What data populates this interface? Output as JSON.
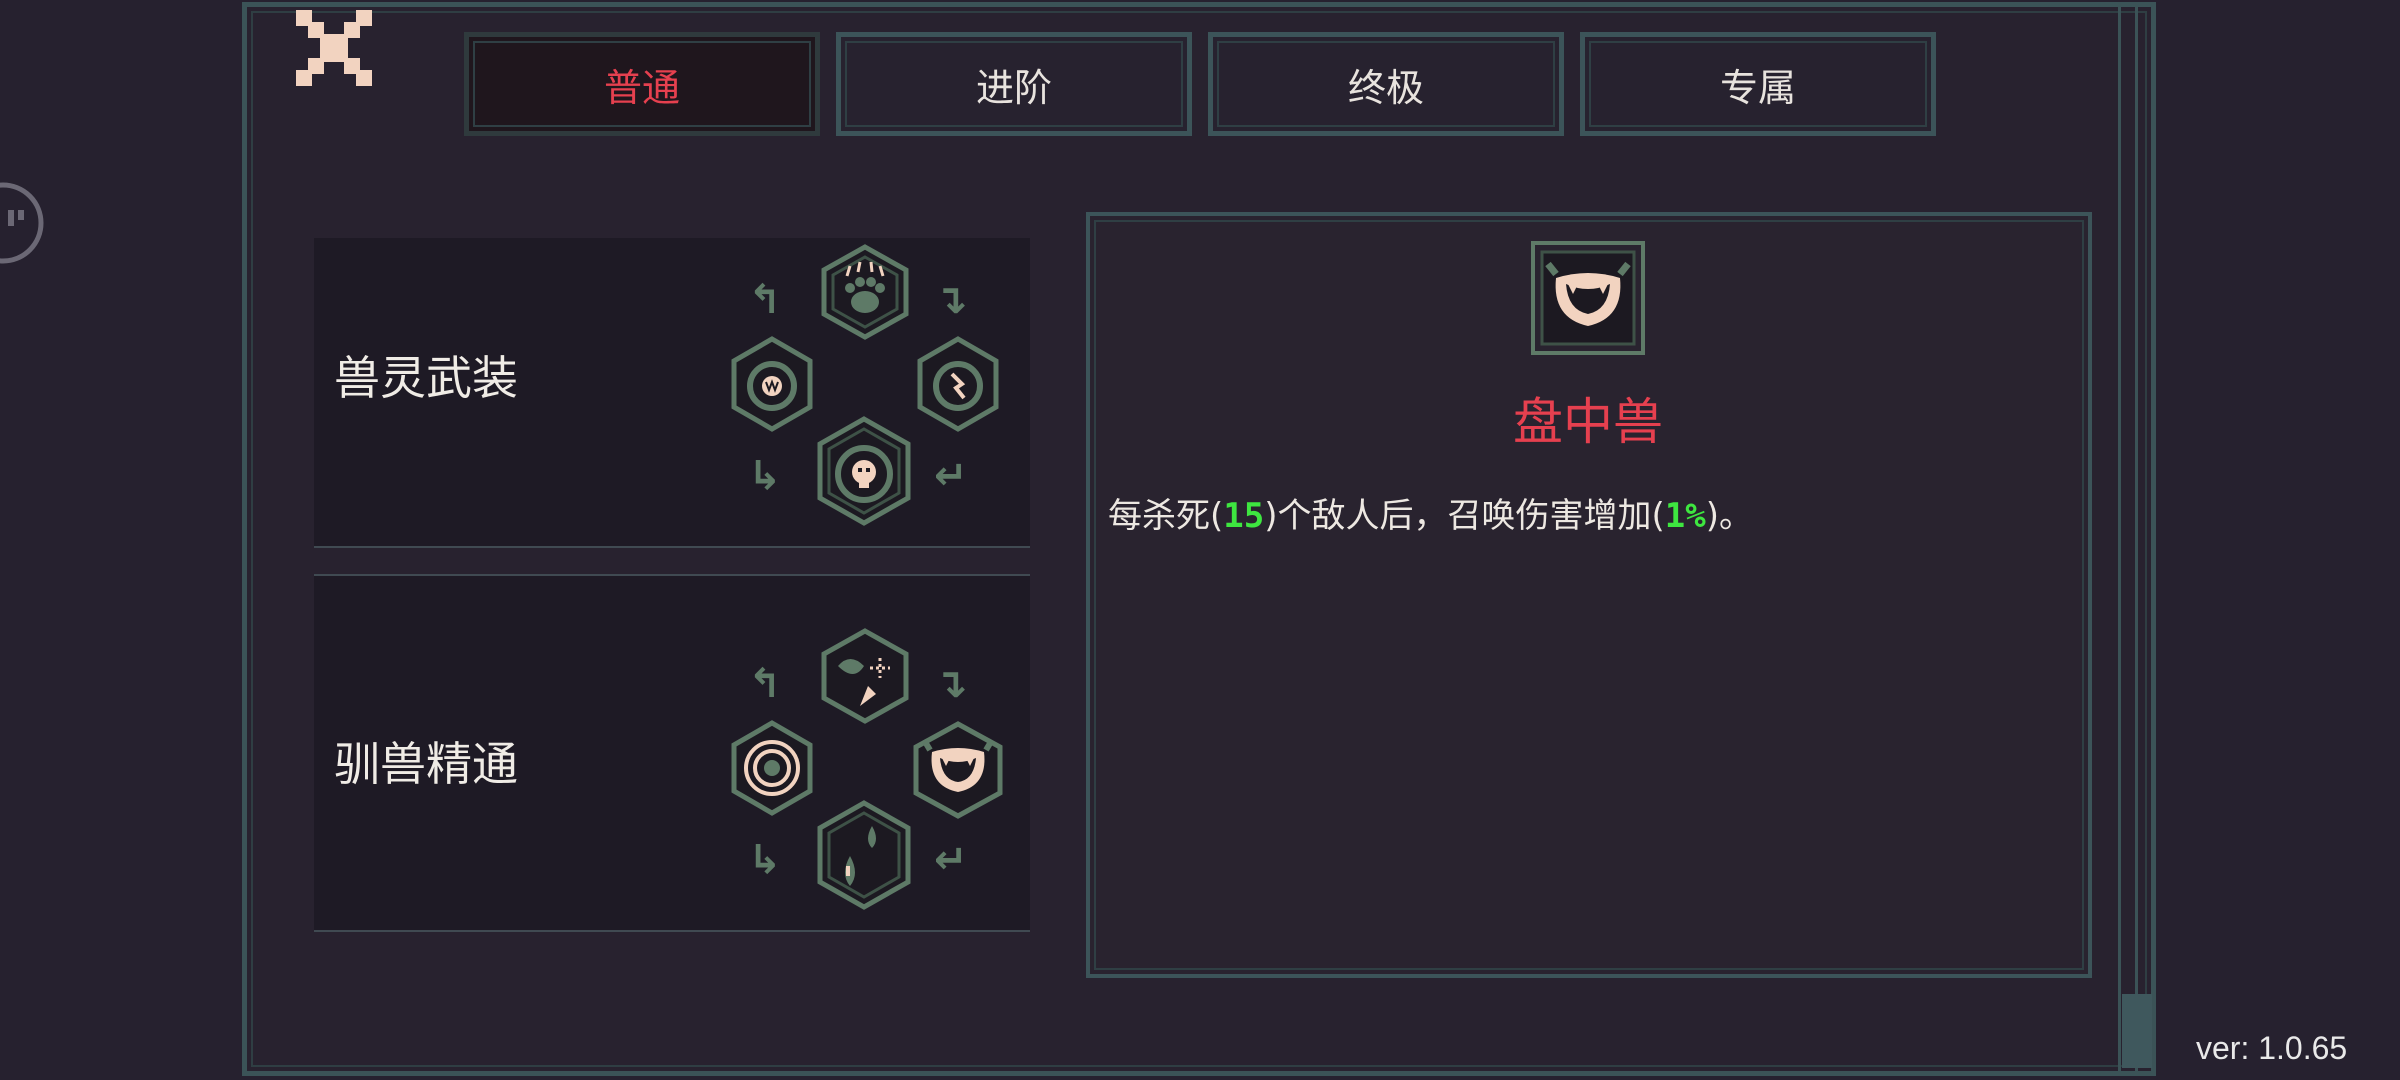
{
  "tabs": [
    {
      "label": "普通",
      "active": true
    },
    {
      "label": "进阶",
      "active": false
    },
    {
      "label": "终极",
      "active": false
    },
    {
      "label": "专属",
      "active": false
    }
  ],
  "categories": [
    {
      "title": "兽灵武装",
      "skills": [
        "paw-claw-icon",
        "spiral-fang-icon",
        "spiral-claw-icon",
        "spiral-skull-icon"
      ]
    },
    {
      "title": "驯兽精通",
      "skills": [
        "pointer-target-icon",
        "concentric-ring-icon",
        "fanged-mouth-icon",
        "droplets-icon"
      ]
    }
  ],
  "detail": {
    "icon": "fanged-mouth-icon",
    "title": "盘中兽",
    "desc_before": "每杀死(",
    "value1": "15",
    "desc_middle": ")个敌人后，召唤伤害增加(",
    "value2": "1%",
    "desc_after": ")。"
  },
  "version": "ver: 1.0.65",
  "colors": {
    "background": "#26212f",
    "frame": "#3c5459",
    "accent_red": "#e6404f",
    "value_green": "#3ee640",
    "icon_green": "#5e7a67"
  }
}
